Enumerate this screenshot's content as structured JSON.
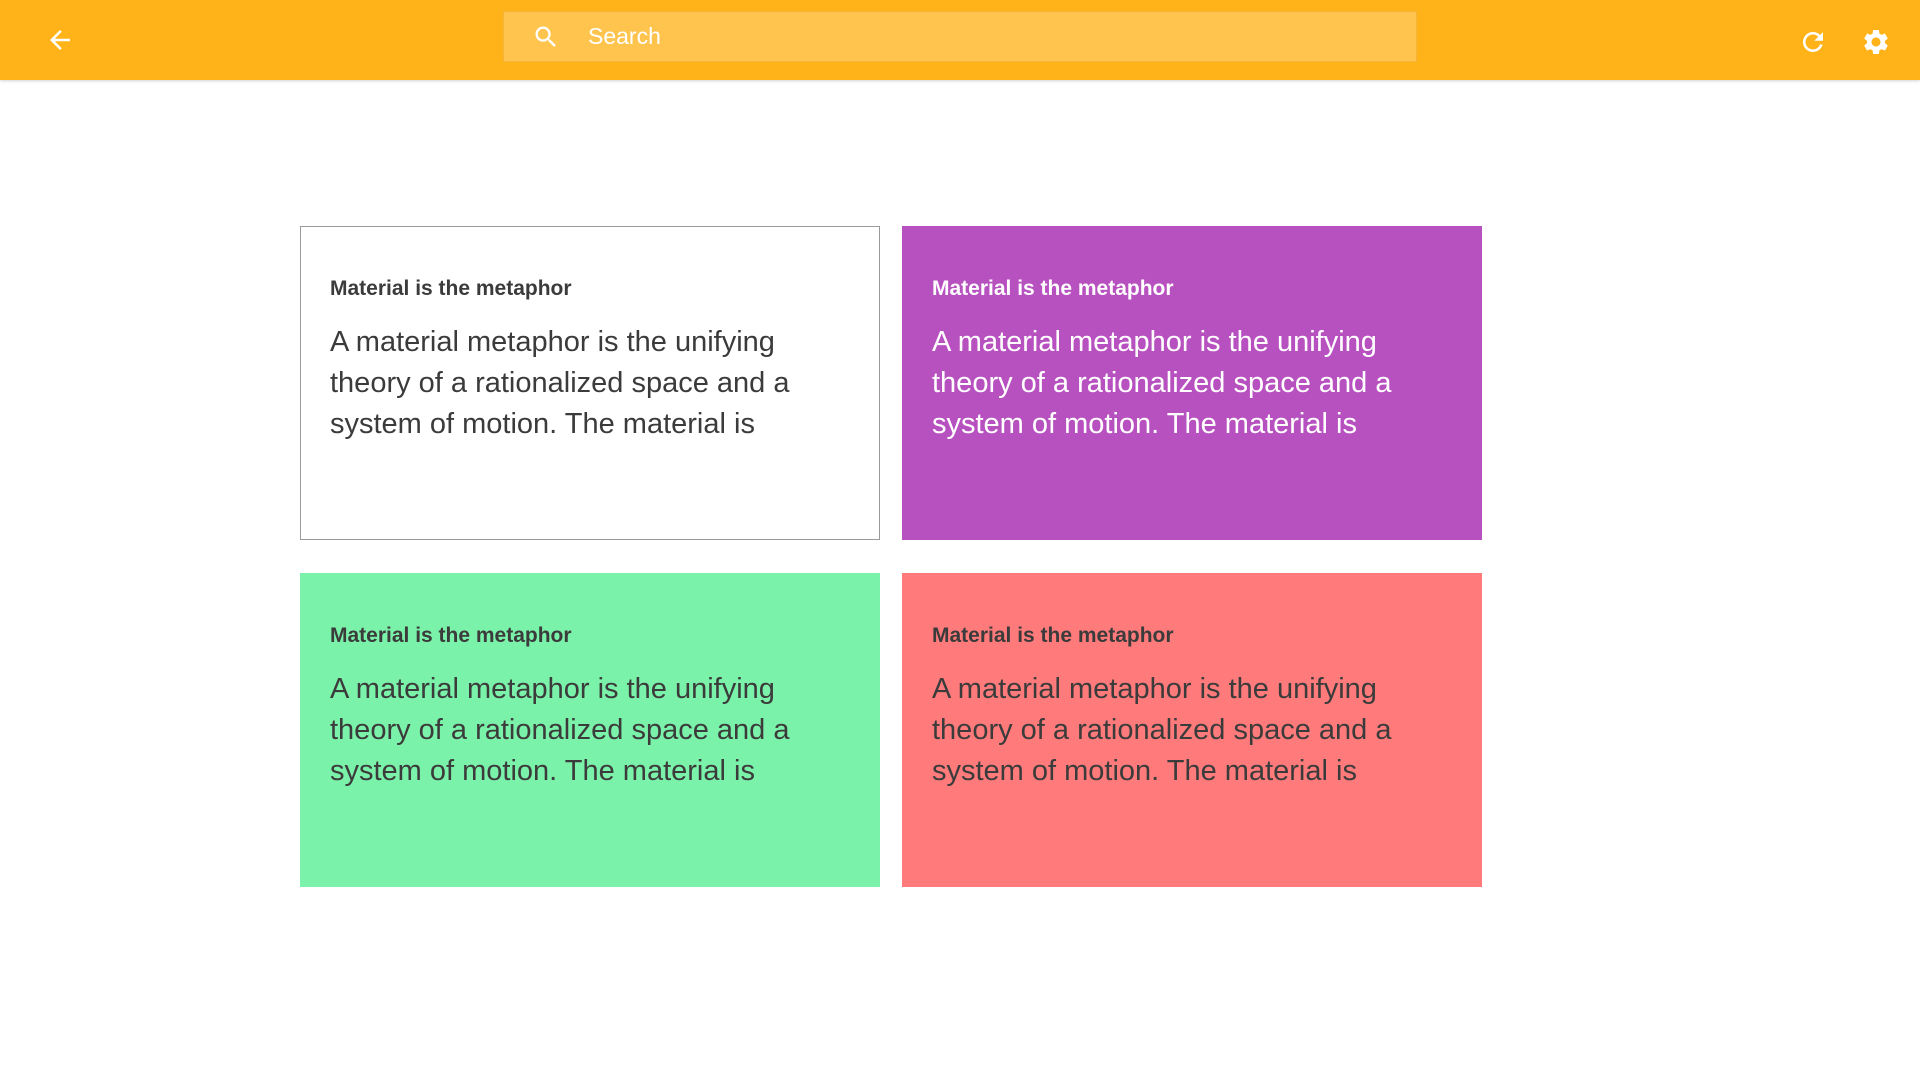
{
  "appbar": {
    "background": "#FFB319",
    "back_icon": "arrow-left-icon",
    "refresh_icon": "refresh-icon",
    "settings_icon": "gear-icon"
  },
  "search": {
    "placeholder": "Search",
    "value": "",
    "icon": "search-icon"
  },
  "cards": [
    {
      "title": "Material is the metaphor",
      "body": "A material metaphor is the unifying theory of a rationalized space and a system of motion. The material is",
      "background": "#FFFFFF"
    },
    {
      "title": "Material is the metaphor",
      "body": "A material metaphor is the unifying theory of a rationalized space and a system of motion. The material is",
      "background": "#B851C0"
    },
    {
      "title": "Material is the metaphor",
      "body": "A material metaphor is the unifying theory of a rationalized space and a system of motion. The material is",
      "background": "#7BF2A9"
    },
    {
      "title": "Material is the metaphor",
      "body": "A material metaphor is the unifying theory of a rationalized space and a system of motion. The material is",
      "background": "#FF7B7B"
    }
  ]
}
